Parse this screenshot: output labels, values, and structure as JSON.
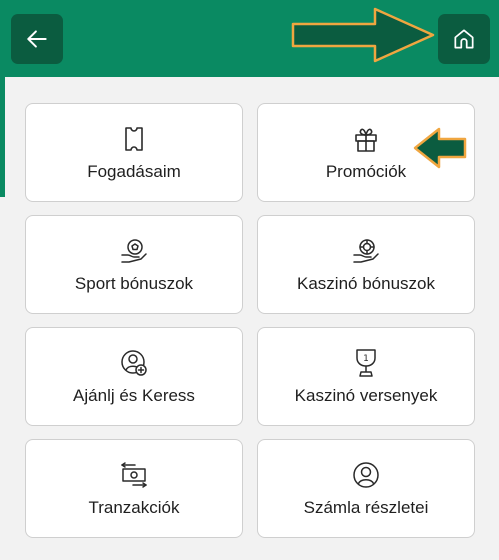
{
  "header": {
    "back_icon": "arrow-left-icon",
    "home_icon": "home-icon",
    "bar_color": "#0a8a62",
    "button_color": "#0b5c40"
  },
  "menu": {
    "items": [
      {
        "label": "Fogadásaim",
        "icon": "ticket-icon"
      },
      {
        "label": "Promóciók",
        "icon": "gift-icon"
      },
      {
        "label": "Sport bónuszok",
        "icon": "hand-ball-icon"
      },
      {
        "label": "Kaszinó bónuszok",
        "icon": "hand-chip-icon"
      },
      {
        "label": "Ajánlj és Keress",
        "icon": "user-plus-icon"
      },
      {
        "label": "Kaszinó versenyek",
        "icon": "trophy-icon"
      },
      {
        "label": "Tranzakciók",
        "icon": "banknote-transfer-icon"
      },
      {
        "label": "Számla részletei",
        "icon": "account-icon"
      }
    ]
  },
  "annotations": {
    "arrow_fill": "#0b5c40",
    "arrow_outline": "#f0a640"
  }
}
